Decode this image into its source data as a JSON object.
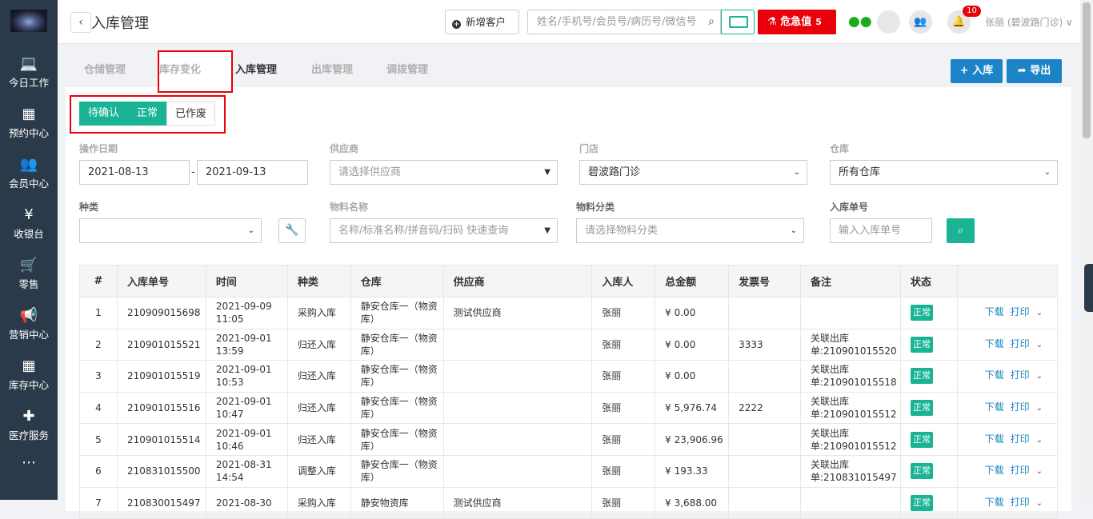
{
  "sidebar": {
    "items": [
      {
        "label": "今日工作",
        "icon": "laptop-icon",
        "glyph": "💻"
      },
      {
        "label": "预约中心",
        "icon": "calendar-icon",
        "glyph": "▦"
      },
      {
        "label": "会员中心",
        "icon": "users-icon",
        "glyph": "👥"
      },
      {
        "label": "收银台",
        "icon": "yen-icon",
        "glyph": "¥"
      },
      {
        "label": "零售",
        "icon": "cart-icon",
        "glyph": "🛒"
      },
      {
        "label": "营销中心",
        "icon": "megaphone-icon",
        "glyph": "📢"
      },
      {
        "label": "库存中心",
        "icon": "grid-icon",
        "glyph": "▦"
      },
      {
        "label": "医疗服务",
        "icon": "medkit-icon",
        "glyph": "✚"
      },
      {
        "label": "",
        "icon": "more-icon",
        "glyph": "⋯"
      }
    ]
  },
  "topbar": {
    "back_glyph": "‹",
    "title": "入库管理",
    "new_customer": "新增客户",
    "search_placeholder": "姓名/手机号/会员号/病历号/微信号",
    "danger_label": "危急值",
    "danger_count": "5",
    "bell_count": "10",
    "user": "张丽 (碧波路门诊) ∨"
  },
  "tabs": [
    {
      "label": "仓储管理"
    },
    {
      "label": "库存变化"
    },
    {
      "label": "入库管理"
    },
    {
      "label": "出库管理"
    },
    {
      "label": "调拨管理"
    }
  ],
  "actions": {
    "stock_in": "+ 入库",
    "export": "导出"
  },
  "status_segments": [
    "待确认",
    "正常",
    "已作废"
  ],
  "filters": {
    "date_label": "操作日期",
    "date_from": "2021-08-13",
    "date_to": "2021-09-13",
    "supplier_label": "供应商",
    "supplier_placeholder": "请选择供应商",
    "store_label": "门店",
    "store_value": "碧波路门诊",
    "warehouse_label": "仓库",
    "warehouse_value": "所有仓库",
    "kind_label": "种类",
    "material_label": "物料名称",
    "material_placeholder": "名称/标准名称/拼音码/扫码 快速查询",
    "category_label": "物料分类",
    "category_placeholder": "请选择物料分类",
    "order_label": "入库单号",
    "order_placeholder": "输入入库单号"
  },
  "table": {
    "headers": [
      "#",
      "入库单号",
      "时间",
      "种类",
      "仓库",
      "供应商",
      "入库人",
      "总金额",
      "发票号",
      "备注",
      "状态",
      ""
    ],
    "rows": [
      {
        "idx": "1",
        "no": "210909015698",
        "time": "2021-09-09 11:05",
        "kind": "采购入库",
        "wh": "静安仓库一（物资库）",
        "supplier": "测试供应商",
        "person": "张丽",
        "amount": "¥ 0.00",
        "invoice": "",
        "note": "",
        "status": "正常"
      },
      {
        "idx": "2",
        "no": "210901015521",
        "time": "2021-09-01 13:59",
        "kind": "归还入库",
        "wh": "静安仓库一（物资库）",
        "supplier": "",
        "person": "张丽",
        "amount": "¥ 0.00",
        "invoice": "3333",
        "note": "关联出库单:210901015520",
        "status": "正常"
      },
      {
        "idx": "3",
        "no": "210901015519",
        "time": "2021-09-01 10:53",
        "kind": "归还入库",
        "wh": "静安仓库一（物资库）",
        "supplier": "",
        "person": "张丽",
        "amount": "¥ 0.00",
        "invoice": "",
        "note": "关联出库单:210901015518",
        "status": "正常"
      },
      {
        "idx": "4",
        "no": "210901015516",
        "time": "2021-09-01 10:47",
        "kind": "归还入库",
        "wh": "静安仓库一（物资库）",
        "supplier": "",
        "person": "张丽",
        "amount": "¥ 5,976.74",
        "invoice": "2222",
        "note": "关联出库单:210901015512",
        "status": "正常"
      },
      {
        "idx": "5",
        "no": "210901015514",
        "time": "2021-09-01 10:46",
        "kind": "归还入库",
        "wh": "静安仓库一（物资库）",
        "supplier": "",
        "person": "张丽",
        "amount": "¥ 23,906.96",
        "invoice": "",
        "note": "关联出库单:210901015512",
        "status": "正常"
      },
      {
        "idx": "6",
        "no": "210831015500",
        "time": "2021-08-31 14:54",
        "kind": "调整入库",
        "wh": "静安仓库一（物资库）",
        "supplier": "",
        "person": "张丽",
        "amount": "¥ 193.33",
        "invoice": "",
        "note": "关联出库单:210831015497",
        "status": "正常"
      },
      {
        "idx": "7",
        "no": "210830015497",
        "time": "2021-08-30",
        "kind": "采购入库",
        "wh": "静安物资库",
        "supplier": "测试供应商",
        "person": "张丽",
        "amount": "¥ 3,688.00",
        "invoice": "",
        "note": "",
        "status": "正常"
      }
    ],
    "op_download": "下载",
    "op_print": "打印"
  },
  "colors": {
    "sidebar": "#2b3a4a",
    "accent": "#1ab394",
    "primary": "#1c84c6",
    "danger": "#e8000a"
  }
}
